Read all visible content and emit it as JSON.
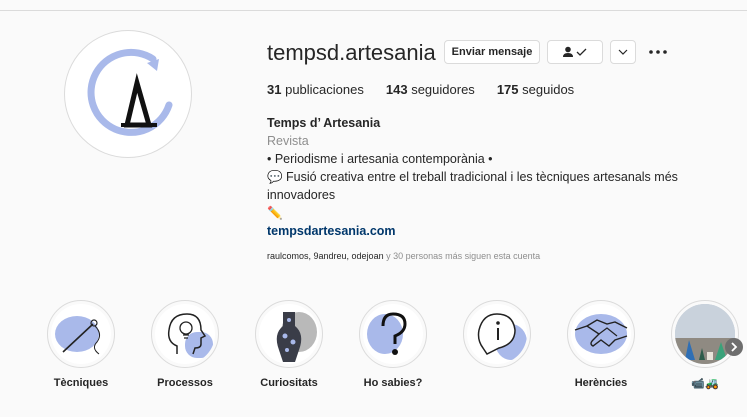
{
  "profile": {
    "username": "tempsd.artesania",
    "message_button": "Enviar mensaje",
    "stats": {
      "posts_count": "31",
      "posts_label": "publicaciones",
      "followers_count": "143",
      "followers_label": "seguidores",
      "following_count": "175",
      "following_label": "seguidos"
    },
    "bio": {
      "name": "Temps d’ Artesania",
      "category": "Revista",
      "line1": "• Periodisme i artesania contemporània •",
      "line2": "💬 Fusió creativa entre el treball tradicional i les tècniques artesanals més innovadores",
      "line3": "✏️",
      "website": "tempsdartesania.com"
    },
    "followed_by": {
      "users": "raulcomos, 9andreu, odejoan",
      "rest": " y 30 personas más siguen esta cuenta"
    }
  },
  "highlights": [
    {
      "label": "Tècniques",
      "icon": "needle-icon"
    },
    {
      "label": "Processos",
      "icon": "lightbulb-head-icon"
    },
    {
      "label": "Curiositats",
      "icon": "artifact-icon"
    },
    {
      "label": "Ho sabies?",
      "icon": "question-icon"
    },
    {
      "label": "",
      "icon": "info-bubble-icon"
    },
    {
      "label": "Herències",
      "icon": "handshake-icon"
    },
    {
      "label": "📹🚜",
      "icon": "photo-thumbnail"
    }
  ],
  "colors": {
    "accent_blue": "#a9b9ea",
    "link": "#00376b",
    "muted": "#8e8e8e",
    "border": "#dbdbdb"
  }
}
